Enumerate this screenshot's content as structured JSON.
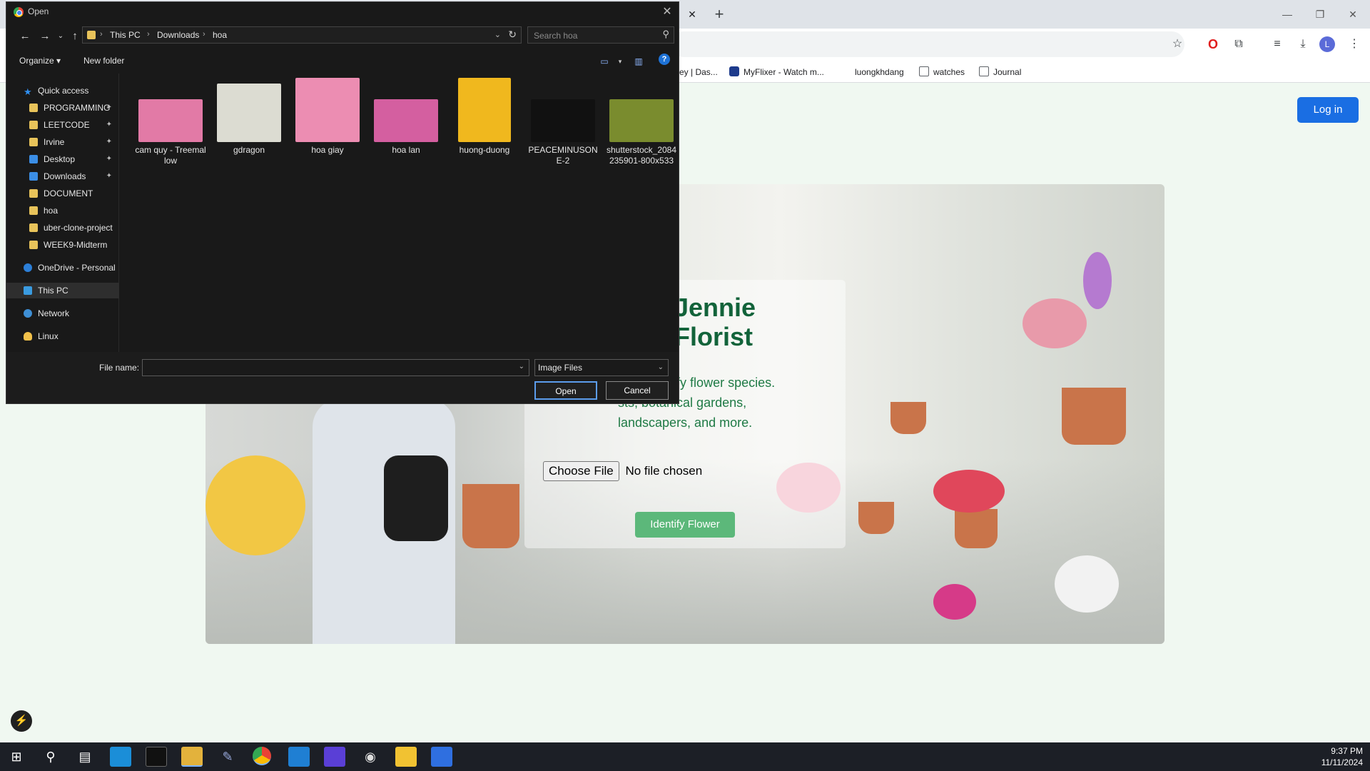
{
  "browser": {
    "tab_close": "✕",
    "new_tab": "+",
    "bookmarks": [
      {
        "label": "ey | Das...",
        "type": "page"
      },
      {
        "label": "MyFlixer - Watch m...",
        "type": "site"
      },
      {
        "label": "luongkhdang",
        "type": "page"
      },
      {
        "label": "watches",
        "type": "folder"
      },
      {
        "label": "Journal",
        "type": "folder"
      }
    ],
    "avatar_letter": "L"
  },
  "page": {
    "login_label": "Log in",
    "brand_line1": "Jennie",
    "brand_line2": "Florist",
    "description_line1": "al to identify flower species.",
    "description_line2": "sts, botanical gardens,",
    "description_line3": "landscapers, and more.",
    "choose_file_label": "Choose File",
    "no_file_label": "No file chosen",
    "identify_label": "Identify Flower"
  },
  "dialog": {
    "title": "Open",
    "breadcrumb": [
      "This PC",
      "Downloads",
      "hoa"
    ],
    "search_placeholder": "Search hoa",
    "organize_label": "Organize ▾",
    "new_folder_label": "New folder",
    "help_label": "?",
    "nav": {
      "quick_access": "Quick access",
      "items": [
        {
          "label": "PROGRAMMING",
          "pinned": true
        },
        {
          "label": "LEETCODE",
          "pinned": true
        },
        {
          "label": "Irvine",
          "pinned": true
        },
        {
          "label": "Desktop",
          "pinned": true
        },
        {
          "label": "Downloads",
          "pinned": true
        },
        {
          "label": "DOCUMENT",
          "pinned": false
        },
        {
          "label": "hoa",
          "pinned": false
        },
        {
          "label": "uber-clone-project",
          "pinned": false
        },
        {
          "label": "WEEK9-Midterm",
          "pinned": false
        }
      ],
      "onedrive": "OneDrive - Personal",
      "this_pc": "This PC",
      "network": "Network",
      "linux": "Linux"
    },
    "files": [
      {
        "name": "cam quy - Treemallow",
        "color": "#e27aa6"
      },
      {
        "name": "gdragon",
        "color": "#dcdcd2"
      },
      {
        "name": "hoa giay",
        "color": "#ec8db2"
      },
      {
        "name": "hoa lan",
        "color": "#d45fa0"
      },
      {
        "name": "huong-duong",
        "color": "#f0b81e"
      },
      {
        "name": "PEACEMINUSONE-2",
        "color": "#111111"
      },
      {
        "name": "shutterstock_2084235901-800x533",
        "color": "#7a8c2e"
      }
    ],
    "file_name_label": "File name:",
    "file_name_value": "",
    "file_type": "Image Files",
    "open_label": "Open",
    "cancel_label": "Cancel"
  },
  "taskbar": {
    "time": "9:37 PM",
    "date": "11/11/2024"
  }
}
